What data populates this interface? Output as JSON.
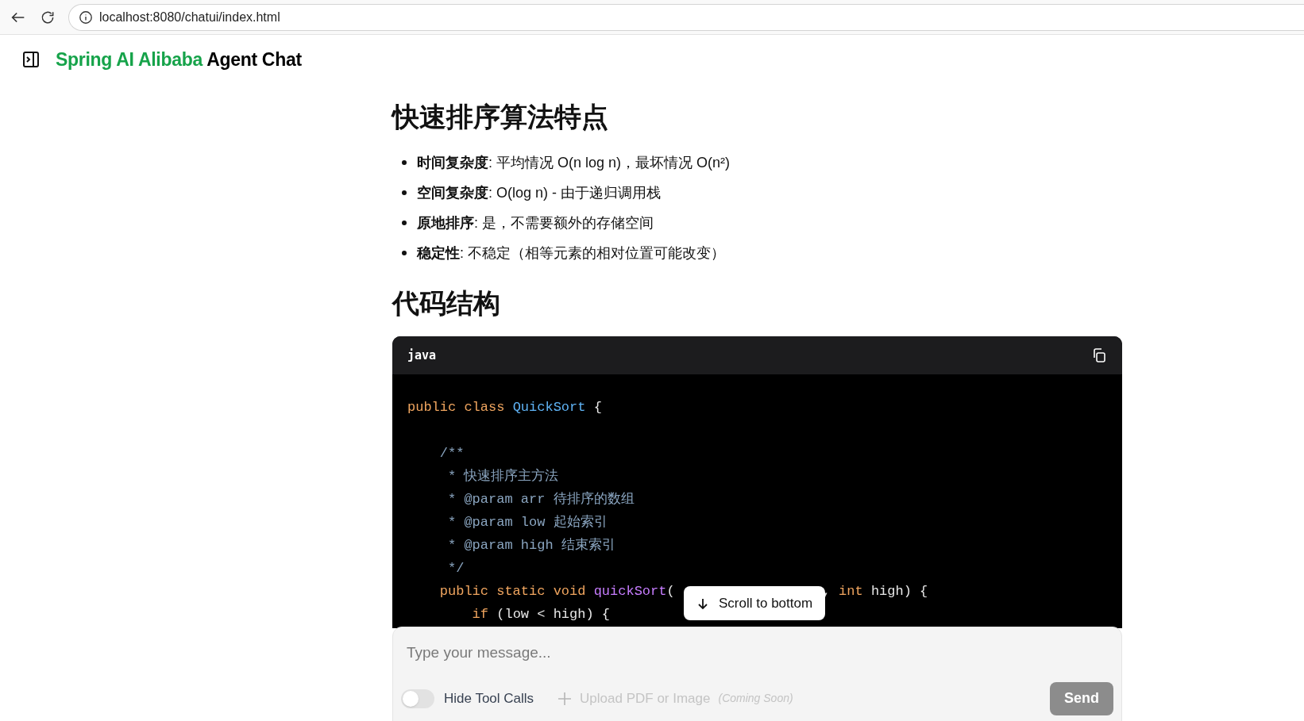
{
  "browser": {
    "url": "localhost:8080/chatui/index.html"
  },
  "header": {
    "brand": "Spring AI Alibaba",
    "title": "Agent Chat"
  },
  "article": {
    "heading_1": "快速排序算法特点",
    "bullets": [
      "**时间复杂度**: 平均情况 O(n log n)，最坏情况 O(n²)",
      "**空间复杂度**: O(log n) - 由于递归调用栈",
      "**原地排序**: 是，不需要额外的存储空间",
      "**稳定性**: 不稳定（相等元素的相对位置可能改变）"
    ],
    "heading_2": "代码结构",
    "code_block": {
      "language": "java",
      "lines": [
        {
          "kind": "code",
          "tokens": [
            {
              "kind": "keyword",
              "text": "public "
            },
            {
              "kind": "keyword",
              "text": "class "
            },
            {
              "kind": "type",
              "text": "QuickSort"
            },
            {
              "kind": "plain",
              "text": " {"
            }
          ]
        },
        {
          "kind": "blank"
        },
        {
          "kind": "code",
          "tokens": [
            {
              "kind": "comment",
              "text": "    /**"
            }
          ]
        },
        {
          "kind": "code",
          "tokens": [
            {
              "kind": "comment",
              "text": "     * 快速排序主方法"
            }
          ]
        },
        {
          "kind": "code",
          "tokens": [
            {
              "kind": "comment",
              "text": "     * @param arr 待排序的数组"
            }
          ]
        },
        {
          "kind": "code",
          "tokens": [
            {
              "kind": "comment",
              "text": "     * @param low 起始索引"
            }
          ]
        },
        {
          "kind": "code",
          "tokens": [
            {
              "kind": "comment",
              "text": "     * @param high 结束索引"
            }
          ]
        },
        {
          "kind": "code",
          "tokens": [
            {
              "kind": "comment",
              "text": "     */"
            }
          ]
        },
        {
          "kind": "code",
          "tokens": [
            {
              "kind": "keyword",
              "text": "    public static void "
            },
            {
              "kind": "function",
              "text": "quickSort"
            },
            {
              "kind": "plain",
              "text": "("
            },
            {
              "kind": "hidden"
            },
            {
              "kind": "plain",
              "text": ", "
            },
            {
              "kind": "keyword",
              "text": "int"
            },
            {
              "kind": "plain",
              "text": " high) {"
            }
          ]
        },
        {
          "kind": "code",
          "tokens": [
            {
              "kind": "keyword",
              "text": "        if"
            },
            {
              "kind": "plain",
              "text": " (low < high) {"
            }
          ]
        }
      ]
    }
  },
  "scroll_button": {
    "label": "Scroll to bottom"
  },
  "composer": {
    "placeholder": "Type your message...",
    "hide_tool_calls": {
      "label": "Hide Tool Calls",
      "on": false
    },
    "upload": {
      "label": "Upload PDF or Image",
      "note": "(Coming Soon)",
      "disabled": true
    },
    "send": {
      "label": "Send",
      "disabled": true
    }
  }
}
